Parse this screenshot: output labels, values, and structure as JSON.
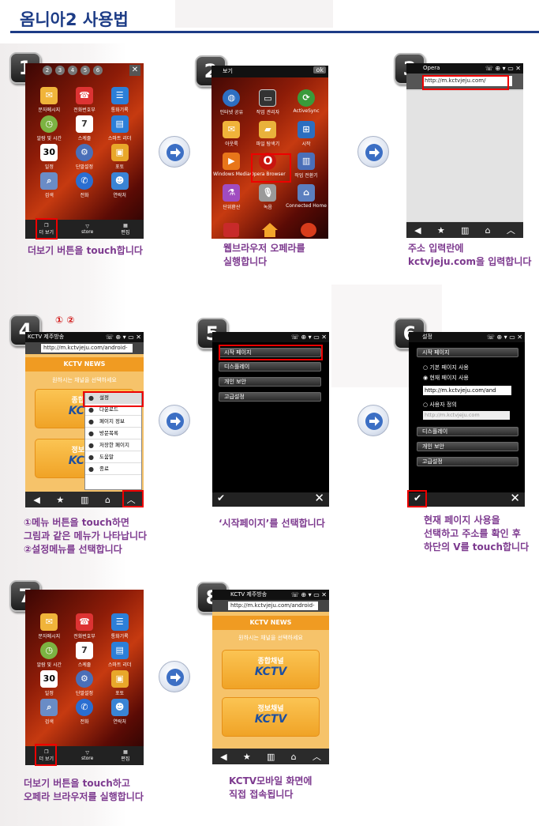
{
  "title": "옴니아2 사용법",
  "steps": {
    "s1": {
      "num": "1",
      "caption": "더보기 버튼을 touch합니다"
    },
    "s2": {
      "num": "2",
      "caption_l1": "웹브라우저 오페라를",
      "caption_l2": "실행합니다"
    },
    "s3": {
      "num": "3",
      "caption_l1": "주소 입력란에",
      "caption_l2": "kctvjeju.com을 입력합니다"
    },
    "s4": {
      "num": "4",
      "marks": "① ②",
      "caption_l1": "①메뉴 버튼을 touch하면",
      "caption_l2": "그림과 같은 메뉴가 나타납니다",
      "caption_l3": "②설정메뉴를 선택합니다"
    },
    "s5": {
      "num": "5",
      "caption": "‘시작페이지’를 선택합니다"
    },
    "s6": {
      "num": "6",
      "caption_l1": "현재 페이지 사용을",
      "caption_l2": "선택하고 주소를 확인 후",
      "caption_l3": "하단의 V를 touch합니다"
    },
    "s7": {
      "num": "7",
      "caption_l1": "더보기 버튼을 touch하고",
      "caption_l2": "오페라 브라우저를 실행합니다"
    },
    "s8": {
      "num": "8",
      "caption_l1": "KCTV모바일 화면에",
      "caption_l2": "직접 접속됩니다"
    }
  },
  "home": {
    "tabs": [
      "2",
      "3",
      "4",
      "5",
      "6"
    ],
    "apps": [
      "문자메시지",
      "전화번호부",
      "통화기록",
      "알람 및 시간",
      "스케줄",
      "스마트 리더",
      "일정",
      "단말설정",
      "포토",
      "검색",
      "전화",
      "연락처"
    ],
    "dock": [
      "더 보기",
      "store",
      "편집"
    ]
  },
  "more": {
    "header": "보기",
    "ok": "ok",
    "apps": [
      "인터넷 공유",
      "작업 관리자",
      "ActiveSync",
      "아웃룩",
      "파일 탐색기",
      "시작",
      "Windows Media",
      "Opera Browser",
      "작업 전환기",
      "단위환산",
      "녹음",
      "Connected Home"
    ]
  },
  "opera": {
    "status": "Opera",
    "url": "http://m.kctvjeju.com/"
  },
  "kctv": {
    "status": "KCTV 제주방송",
    "url": "http://m.kctvjeju.com/android-",
    "logo": "KCTV NEWS",
    "prompt": "원하시는 채널을 선택하세요",
    "btn1": "종합채널",
    "btn2": "정보채널",
    "brand": "KCTV",
    "menu": [
      "설정",
      "다운로드",
      "페이지 정보",
      "방문목록",
      "저장한 페이지",
      "도움말",
      "종료"
    ]
  },
  "settings": {
    "header": "설정",
    "items": [
      "시작 페이지",
      "디스플레이",
      "개인 보안",
      "고급설정"
    ],
    "opt1": "기본 페이지 사용",
    "opt2": "현재 페이지 사용",
    "opt3": "사용자 정의",
    "start_url": "http://m.kctvjeju.com/and",
    "placeholder": "http://m.kctvjeju.com"
  },
  "colors": {
    "title": "#1d3c86",
    "caption": "#7d3a8f",
    "highlight": "#e00000",
    "kctv_orange": "#f09b22"
  }
}
